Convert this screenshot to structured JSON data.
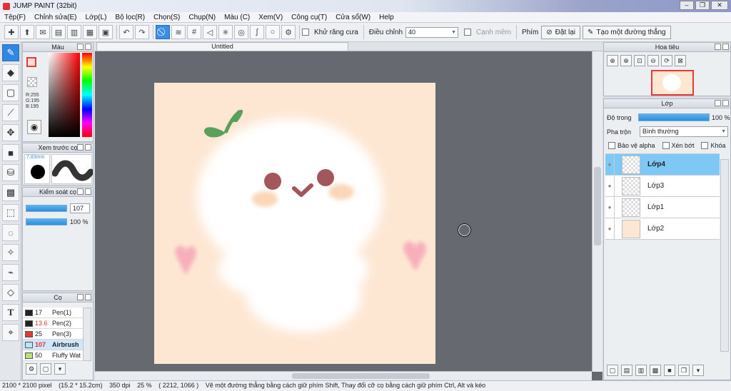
{
  "window": {
    "title": "JUMP PAINT (32bit)",
    "min": "–",
    "max": "❐",
    "close": "✕"
  },
  "menu": [
    "Tệp(F)",
    "Chỉnh sửa(E)",
    "Lớp(L)",
    "Bộ lọc(R)",
    "Chọn(S)",
    "Chụp(N)",
    "Màu (C)",
    "Xem(V)",
    "Công cụ(T)",
    "Cửa sổ(W)",
    "Help"
  ],
  "toolbar": {
    "antialias_label": "Khử răng cưa",
    "adjust_label": "Điều chỉnh",
    "adjust_value": "40",
    "smooth_label": "Cạnh mềm",
    "key_label": "Phím",
    "reset_label": "Đặt lại",
    "ruler_label": "Tạo một đường thẳng"
  },
  "color_panel": {
    "title": "Màu",
    "r": "R:255",
    "g": "G:195",
    "b": "B:195",
    "fg": "#ffdede"
  },
  "brush_preview": {
    "title": "Xem trước cọ",
    "size": "7.83mm"
  },
  "brush_control": {
    "title": "Kiểm soát cọ",
    "size_value": "107",
    "opacity_value": "100 %"
  },
  "brushes": {
    "title": "Cọ",
    "items": [
      {
        "size": "17",
        "name": "Pen(1)",
        "color": "#222222"
      },
      {
        "size": "13.6",
        "name": "Pen(2)",
        "color": "#222222"
      },
      {
        "size": "25",
        "name": "Pen(3)",
        "color": "#e53935"
      },
      {
        "size": "107",
        "name": "Airbrush",
        "color": "#bde3f7"
      },
      {
        "size": "50",
        "name": "Fluffy Wat",
        "color": "#b6e27a"
      }
    ]
  },
  "document": {
    "tab": "Untitled"
  },
  "navigator": {
    "title": "Hoa tiêu"
  },
  "layers": {
    "title": "Lớp",
    "opacity_label": "Độ trong",
    "opacity_value": "100 %",
    "blend_label": "Pha trộn",
    "blend_value": "Bình thường",
    "protect_alpha": "Bảo vệ alpha",
    "clip": "Xén bớt",
    "lock": "Khóa",
    "items": [
      {
        "name": "Lớp4",
        "selected": true
      },
      {
        "name": "Lớp3",
        "selected": false
      },
      {
        "name": "Lớp1",
        "selected": false
      },
      {
        "name": "Lớp2",
        "selected": false
      }
    ]
  },
  "status": {
    "size": "2100 * 2100 pixel",
    "cm": "(15.2 * 15.2cm)",
    "dpi": "350 dpi",
    "zoom": "25 %",
    "coord": "( 2212, 1066 )",
    "hint": "Vẽ một đường thẳng bằng cách giữ phím Shift, Thay đổi cỡ cọ bằng cách giữ phím Ctrl, Alt và kéo"
  }
}
